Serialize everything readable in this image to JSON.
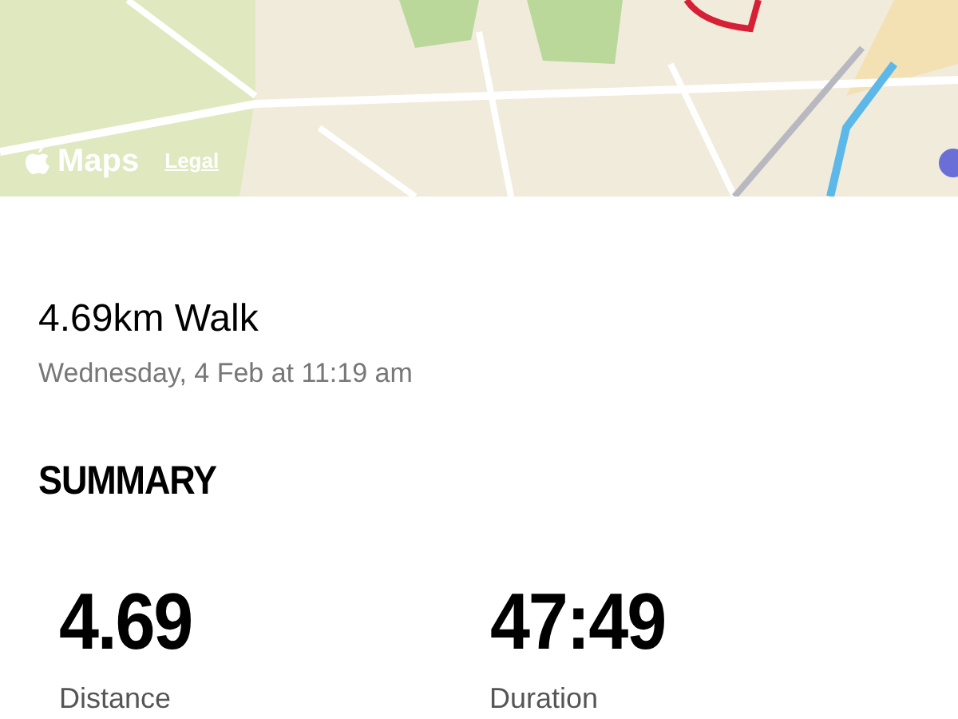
{
  "map": {
    "brand": "Maps",
    "legal_link": "Legal"
  },
  "workout": {
    "title": "4.69km Walk",
    "date": "Wednesday, 4 Feb at 11:19 am"
  },
  "summary": {
    "heading": "SUMMARY",
    "stats": [
      {
        "value": "4.69",
        "label": "Distance"
      },
      {
        "value": "47:49",
        "label": "Duration"
      }
    ]
  }
}
